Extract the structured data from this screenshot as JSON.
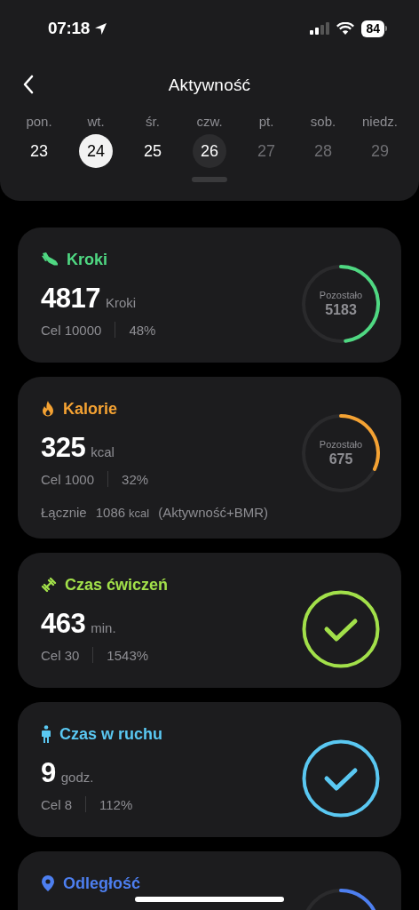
{
  "status_bar": {
    "time": "07:18",
    "battery": "84"
  },
  "header": {
    "title": "Aktywność"
  },
  "week": [
    {
      "weekday": "pon.",
      "date": "23",
      "selected": false,
      "today": false,
      "disabled": false
    },
    {
      "weekday": "wt.",
      "date": "24",
      "selected": true,
      "today": false,
      "disabled": false
    },
    {
      "weekday": "śr.",
      "date": "25",
      "selected": false,
      "today": false,
      "disabled": false
    },
    {
      "weekday": "czw.",
      "date": "26",
      "selected": false,
      "today": true,
      "disabled": false
    },
    {
      "weekday": "pt.",
      "date": "27",
      "selected": false,
      "today": false,
      "disabled": true
    },
    {
      "weekday": "sob.",
      "date": "28",
      "selected": false,
      "today": false,
      "disabled": true
    },
    {
      "weekday": "niedz.",
      "date": "29",
      "selected": false,
      "today": false,
      "disabled": true
    }
  ],
  "cards": [
    {
      "kind": "ring",
      "title": "Kroki",
      "color": "#4fd882",
      "value": "4817",
      "unit": "Kroki",
      "goal": "Cel 10000",
      "percent": "48%",
      "remaining_label": "Pozostało",
      "remaining": "5183"
    },
    {
      "kind": "ring",
      "title": "Kalorie",
      "color": "#f4a233",
      "value": "325",
      "unit": "kcal",
      "goal": "Cel 1000",
      "percent": "32%",
      "remaining_label": "Pozostało",
      "remaining": "675",
      "total": {
        "label": "Łącznie",
        "value": "1086",
        "unit": "kcal",
        "note": "(Aktywność+BMR)"
      }
    },
    {
      "kind": "done",
      "title": "Czas ćwiczeń",
      "color": "#a2e04a",
      "value": "463",
      "unit": "min.",
      "goal": "Cel 30",
      "percent": "1543%"
    },
    {
      "kind": "done",
      "title": "Czas w ruchu",
      "color": "#5ac8f2",
      "value": "9",
      "unit": "godz.",
      "goal": "Cel 8",
      "percent": "112%"
    },
    {
      "kind": "ring",
      "title": "Odległość",
      "color": "#4d7ff0"
    }
  ]
}
